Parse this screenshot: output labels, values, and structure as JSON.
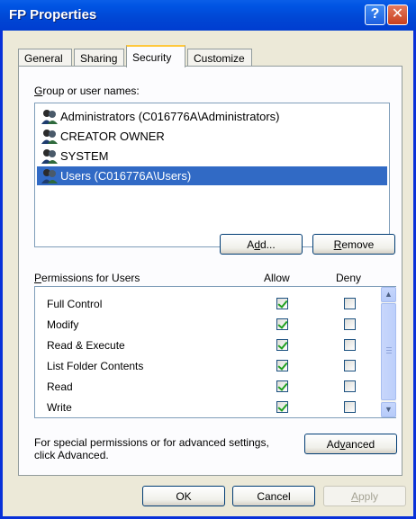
{
  "window": {
    "title": "FP Properties"
  },
  "titlebar": {
    "help_glyph": "?",
    "close_glyph": "✕"
  },
  "tabs": [
    {
      "label": "General"
    },
    {
      "label": "Sharing"
    },
    {
      "label": "Security"
    },
    {
      "label": "Customize"
    }
  ],
  "groups": {
    "label_first": "G",
    "label_rest": "roup or user names:",
    "items": [
      {
        "name": "Administrators (C016776A\\Administrators)"
      },
      {
        "name": "CREATOR OWNER"
      },
      {
        "name": "SYSTEM"
      },
      {
        "name": "Users (C016776A\\Users)"
      }
    ],
    "selected_index": 3
  },
  "buttons": {
    "add_pre": "A",
    "add_u": "d",
    "add_post": "d...",
    "remove_u": "R",
    "remove_post": "emove",
    "advanced_pre": "Ad",
    "advanced_u": "v",
    "advanced_post": "anced",
    "ok": "OK",
    "cancel": "Cancel",
    "apply_u": "A",
    "apply_post": "pply"
  },
  "permissions": {
    "label_u": "P",
    "label_rest": "ermissions for Users",
    "allow_header": "Allow",
    "deny_header": "Deny",
    "rows": [
      {
        "name": "Full Control",
        "allow": true,
        "deny": false
      },
      {
        "name": "Modify",
        "allow": true,
        "deny": false
      },
      {
        "name": "Read & Execute",
        "allow": true,
        "deny": false
      },
      {
        "name": "List Folder Contents",
        "allow": true,
        "deny": false
      },
      {
        "name": "Read",
        "allow": true,
        "deny": false
      },
      {
        "name": "Write",
        "allow": true,
        "deny": false
      }
    ]
  },
  "special": {
    "line1": "For special permissions or for advanced settings,",
    "line2": "click Advanced."
  },
  "colors": {
    "selection": "#316ac5",
    "title_blue": "#0054e3",
    "check_green": "#21a121"
  }
}
